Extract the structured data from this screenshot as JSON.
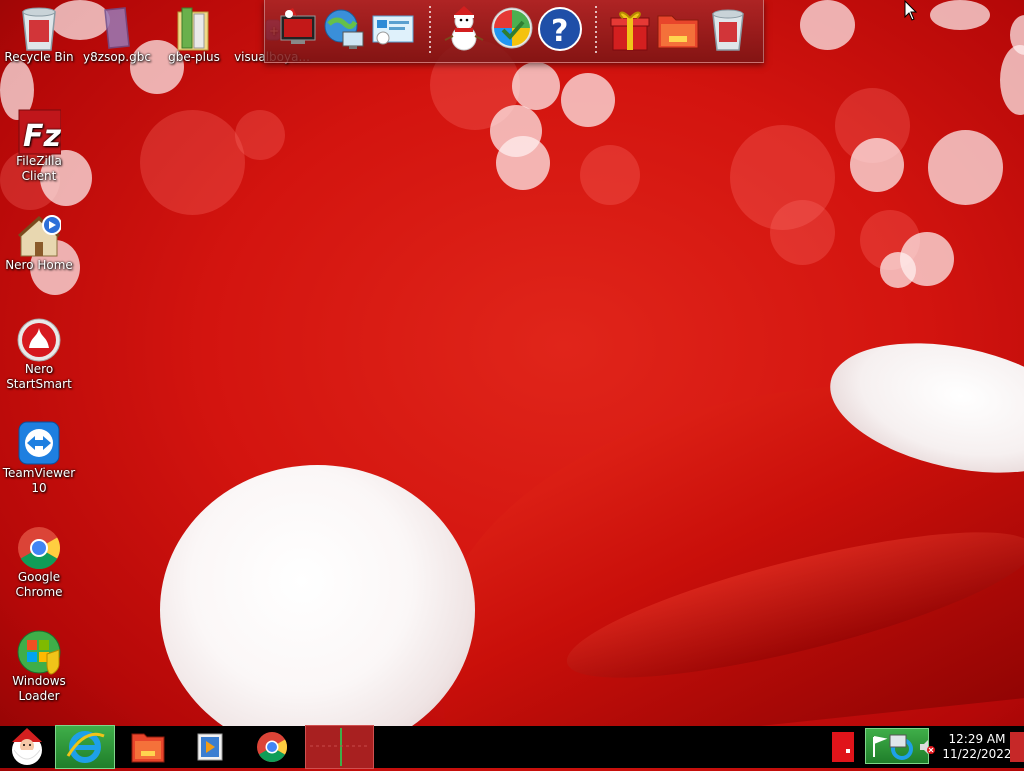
{
  "desktop": {
    "icons": [
      {
        "label": "Recycle Bin",
        "icon": "recycle-bin-icon"
      },
      {
        "label": "y8zsop.gbc",
        "icon": "file-icon"
      },
      {
        "label": "gbe-plus",
        "icon": "folder-icon"
      },
      {
        "label": "visualboya...",
        "icon": "app-icon"
      },
      {
        "label": "FileZilla Client",
        "icon": "filezilla-icon"
      },
      {
        "label": "Nero Home",
        "icon": "nero-home-icon"
      },
      {
        "label": "Nero StartSmart",
        "icon": "nero-startsmart-icon"
      },
      {
        "label": "TeamViewer 10",
        "icon": "teamviewer-icon"
      },
      {
        "label": "Google Chrome",
        "icon": "chrome-icon"
      },
      {
        "label": "Windows Loader",
        "icon": "windows-loader-icon"
      }
    ]
  },
  "dock": {
    "items": [
      {
        "icon": "computer-icon"
      },
      {
        "icon": "network-globe-icon"
      },
      {
        "icon": "control-panel-icon"
      },
      {
        "icon": "snowman-icon"
      },
      {
        "icon": "windows-update-icon"
      },
      {
        "icon": "help-icon",
        "glyph": "?"
      },
      {
        "icon": "gift-icon"
      },
      {
        "icon": "folder-icon"
      },
      {
        "icon": "recycle-bin-icon"
      }
    ]
  },
  "taskbar": {
    "pinned": [
      {
        "icon": "start-santa-icon"
      },
      {
        "icon": "internet-explorer-icon"
      },
      {
        "icon": "file-explorer-icon"
      },
      {
        "icon": "media-player-icon"
      },
      {
        "icon": "chrome-icon"
      },
      {
        "icon": "active-window-icon"
      }
    ],
    "tray": {
      "time": "12:29 AM",
      "date": "11/22/2022"
    }
  },
  "colors": {
    "background": "#d3140f",
    "taskbar": "#000000",
    "accent": "#e82a1c"
  }
}
